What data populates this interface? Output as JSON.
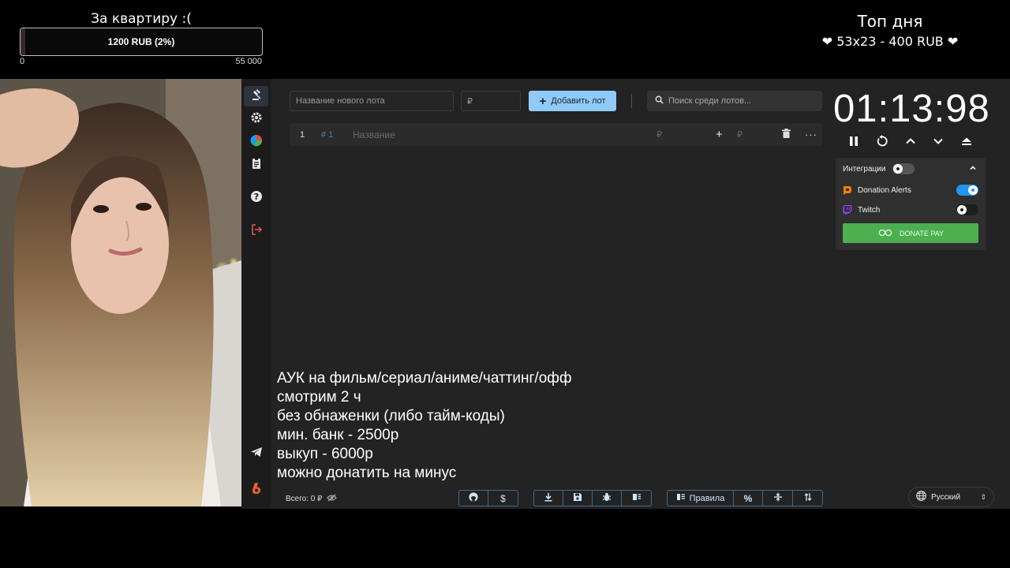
{
  "goal": {
    "title": "За квартиру :(",
    "amount_label": "1200 RUB (2%)",
    "progress_fraction": 0.02,
    "min_label": "0",
    "max_label": "55 000"
  },
  "top_day": {
    "title": "Топ дня",
    "line": "❤ 53x23 - 400 RUB ❤"
  },
  "sidebar": {
    "items": [
      {
        "icon": "gavel-icon",
        "active": true
      },
      {
        "icon": "gear-icon"
      },
      {
        "icon": "pie-chart-icon"
      },
      {
        "icon": "clipboard-icon"
      },
      {
        "icon": "help-icon"
      },
      {
        "icon": "logout-icon"
      },
      {
        "icon": "telegram-icon"
      },
      {
        "icon": "boosty-icon"
      }
    ]
  },
  "toolbar": {
    "lot_name_placeholder": "Название нового лота",
    "lot_price_placeholder": "₽",
    "add_lot_label": "Добавить лот",
    "search_placeholder": "Поиск среди лотов..."
  },
  "lots": [
    {
      "index": "1",
      "id": "# 1",
      "title_placeholder": "Название",
      "currency": "₽",
      "plus": "+",
      "currency_2": "₽",
      "more": "···"
    }
  ],
  "timer": {
    "display": "01:13:98"
  },
  "integrations": {
    "title": "Интеграции",
    "enabled": false,
    "items": [
      {
        "name": "Donation Alerts",
        "enabled": true,
        "color": "#f57d07"
      },
      {
        "name": "Twitch",
        "enabled": false,
        "color": "#9146ff"
      }
    ],
    "donate_pay_label": "DONATE PAY",
    "accent": "#2196f3",
    "donate_pay_color": "#4caf50"
  },
  "rules": [
    "АУК на фильм/сериал/аниме/чаттинг/офф",
    "смотрим 2 ч",
    "без обнаженки (либо тайм-коды)",
    "мин. банк - 2500р",
    "выкуп - 6000р",
    "можно донатить на минус"
  ],
  "footer": {
    "total_label": "Всего: 0 ₽",
    "group_1": [
      {
        "icon": "github-icon"
      },
      {
        "icon": "dollar-icon"
      }
    ],
    "group_2": [
      {
        "icon": "download-icon"
      },
      {
        "icon": "save-icon"
      },
      {
        "icon": "bug-icon"
      },
      {
        "icon": "columns-icon"
      }
    ],
    "group_3": [
      {
        "icon": "rules-icon",
        "label": "Правила"
      },
      {
        "icon": "percent-icon"
      },
      {
        "icon": "split-icon"
      },
      {
        "icon": "sort-icon"
      }
    ],
    "language": "Русский"
  }
}
